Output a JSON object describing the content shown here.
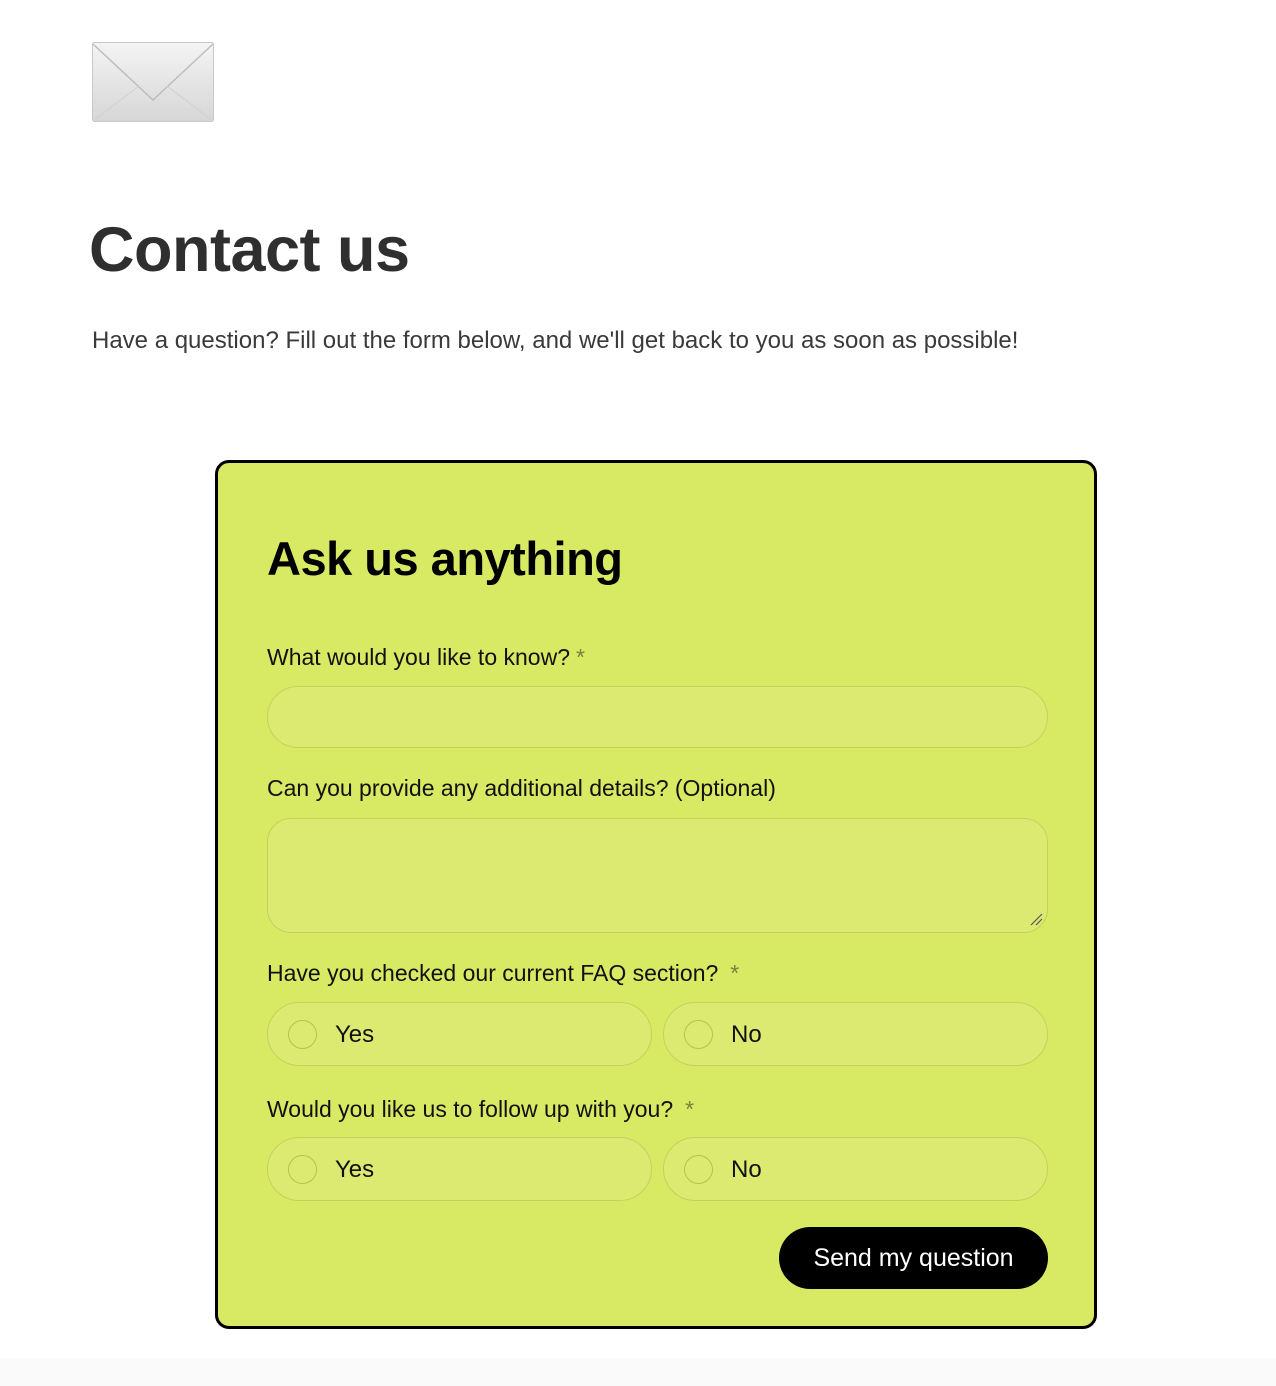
{
  "header": {
    "icon": "envelope-icon",
    "title": "Contact us",
    "intro": "Have a question? Fill out the form below, and we'll get back to you as soon as possible!"
  },
  "form": {
    "title": "Ask us anything",
    "accent_color": "#d8e963",
    "border_color": "#000000",
    "question": {
      "label": "What would you like to know?",
      "required_mark": "*",
      "value": ""
    },
    "details": {
      "label": "Can you provide any additional details? (Optional)",
      "value": ""
    },
    "faq": {
      "label": "Have you checked our current FAQ section?",
      "required_mark": "*",
      "options": [
        "Yes",
        "No"
      ]
    },
    "follow_up": {
      "label": "Would you like us to follow up with you?",
      "required_mark": "*",
      "options": [
        "Yes",
        "No"
      ]
    },
    "submit_label": "Send my question"
  }
}
